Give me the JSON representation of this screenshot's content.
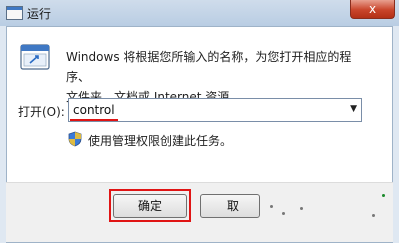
{
  "window": {
    "title": "运行",
    "close_glyph": "x"
  },
  "description": {
    "line1": "Windows 将根据您所输入的名称，为您打开相应的程序、",
    "line2": "文件夹、文档或 Internet 资源。"
  },
  "open_field": {
    "label": "打开(O):",
    "value": "control"
  },
  "admin_note": "使用管理权限创建此任务。",
  "buttons": {
    "ok": "确定",
    "cancel": "取"
  },
  "colors": {
    "highlight": "#e01414",
    "title_bar": "#b9cde3",
    "close_button": "#c9452b"
  },
  "icons": [
    "run-app-icon",
    "run-program-icon",
    "uac-shield-icon",
    "dropdown-arrow-icon",
    "close-icon"
  ]
}
